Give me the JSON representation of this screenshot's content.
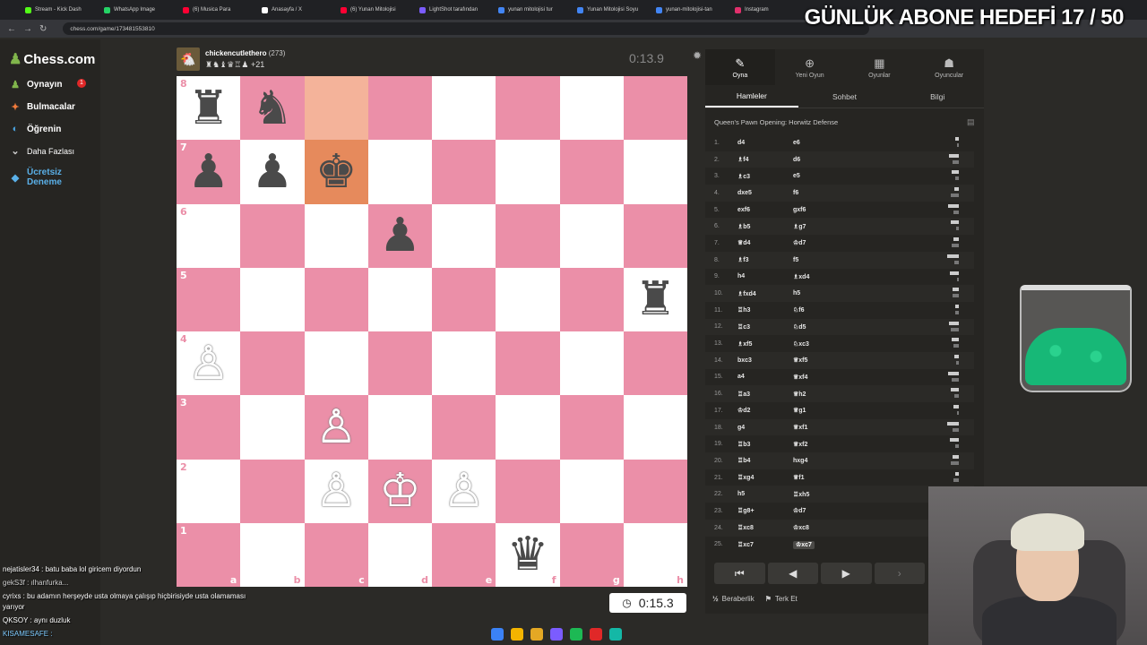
{
  "browser": {
    "tabs": [
      {
        "label": "Stream - Kick Dash",
        "color": "#53fc18"
      },
      {
        "label": "WhatsApp Image",
        "color": "#25d366"
      },
      {
        "label": "(6) Musica Para",
        "color": "#ff0033"
      },
      {
        "label": "Anasayfa / X",
        "color": "#ffffff"
      },
      {
        "label": "(6) Yunan Mitolojisi",
        "color": "#ff0033"
      },
      {
        "label": "LightShot tarafından",
        "color": "#7b5cff"
      },
      {
        "label": "yunan mitolojisi tur",
        "color": "#4285f4"
      },
      {
        "label": "Yunan Mitolojisi Soyu",
        "color": "#4285f4"
      },
      {
        "label": "yunan-mitolojisi-tan",
        "color": "#4285f4"
      },
      {
        "label": "Instagram",
        "color": "#e1306c"
      }
    ],
    "url": "chess.com/game/173481553810"
  },
  "stream_overlay": {
    "title": "GÜNLÜK ABONE HEDEFİ 17 / 50"
  },
  "sidebar": {
    "logo": "Chess.com",
    "items": [
      {
        "label": "Oynayın",
        "icon": "play-icon",
        "glyph": "♟",
        "color": "#81b64c"
      },
      {
        "label": "Bulmacalar",
        "icon": "puzzle-icon",
        "glyph": "✦",
        "color": "#f07a3b"
      },
      {
        "label": "Öğrenin",
        "icon": "learn-icon",
        "glyph": "◐",
        "color": "#4aa3df"
      },
      {
        "label": "Daha Fazlası",
        "icon": "more-icon",
        "glyph": "⌄",
        "color": "#cccccc"
      },
      {
        "label": "Ücretsiz\nDeneme",
        "icon": "diamond-icon",
        "glyph": "◆",
        "color": "#5ab0e8"
      }
    ],
    "notification_count": "1"
  },
  "top_player": {
    "name": "chickencutlethero",
    "rating": "(273)",
    "captured_diff": "+21",
    "captured_pieces": "♜♞♝♛♖♟",
    "clock": "0:13.9"
  },
  "bottom_player": {
    "clock": "0:15.3"
  },
  "board": {
    "ranks": [
      "8",
      "7",
      "6",
      "5",
      "4",
      "3",
      "2",
      "1"
    ],
    "files": [
      "a",
      "b",
      "c",
      "d",
      "e",
      "f",
      "g",
      "h"
    ],
    "pieces": {
      "a8": "♜",
      "b8": "♞",
      "a7": "♟",
      "b7": "♟",
      "c7": "♚",
      "d6": "♟",
      "h5": "♜",
      "a4": "♙",
      "c3": "♙",
      "c2": "♙",
      "d2": "♔",
      "e2": "♙",
      "f1": "♛"
    },
    "white_pieces": [
      "a4",
      "c3",
      "c2",
      "d2",
      "e2"
    ],
    "highlight": [
      "c8",
      "c7"
    ]
  },
  "panel": {
    "tabs": [
      {
        "label": "Oyna",
        "glyph": "✎",
        "icon": "play-tab-icon"
      },
      {
        "label": "Yeni Oyun",
        "glyph": "⊕",
        "icon": "new-game-icon"
      },
      {
        "label": "Oyunlar",
        "glyph": "▦",
        "icon": "games-icon"
      },
      {
        "label": "Oyuncular",
        "glyph": "☗",
        "icon": "players-icon"
      }
    ],
    "subtabs": [
      "Hamleler",
      "Sohbet",
      "Bilgi"
    ],
    "opening": "Queen's Pawn Opening: Horwitz Defense",
    "moves": [
      {
        "n": "1.",
        "w": "d4",
        "b": "e6"
      },
      {
        "n": "2.",
        "w": "♗f4",
        "b": "d6"
      },
      {
        "n": "3.",
        "w": "♗c3",
        "b": "e5"
      },
      {
        "n": "4.",
        "w": "dxe5",
        "b": "f6"
      },
      {
        "n": "5.",
        "w": "exf6",
        "b": "gxf6"
      },
      {
        "n": "6.",
        "w": "♗b5",
        "b": "♗g7"
      },
      {
        "n": "7.",
        "w": "♕d4",
        "b": "♔d7"
      },
      {
        "n": "8.",
        "w": "♗f3",
        "b": "f5"
      },
      {
        "n": "9.",
        "w": "h4",
        "b": "♗xd4"
      },
      {
        "n": "10.",
        "w": "♗fxd4",
        "b": "h5"
      },
      {
        "n": "11.",
        "w": "♖h3",
        "b": "♘f6"
      },
      {
        "n": "12.",
        "w": "♖c3",
        "b": "♘d5"
      },
      {
        "n": "13.",
        "w": "♗xf5",
        "b": "♘xc3"
      },
      {
        "n": "14.",
        "w": "bxc3",
        "b": "♕xf5"
      },
      {
        "n": "15.",
        "w": "a4",
        "b": "♕xf4"
      },
      {
        "n": "16.",
        "w": "♖a3",
        "b": "♕h2"
      },
      {
        "n": "17.",
        "w": "♔d2",
        "b": "♕g1"
      },
      {
        "n": "18.",
        "w": "g4",
        "b": "♕xf1"
      },
      {
        "n": "19.",
        "w": "♖b3",
        "b": "♕xf2"
      },
      {
        "n": "20.",
        "w": "♖b4",
        "b": "hxg4"
      },
      {
        "n": "21.",
        "w": "♖xg4",
        "b": "♕f1"
      },
      {
        "n": "22.",
        "w": "h5",
        "b": "♖xh5"
      },
      {
        "n": "23.",
        "w": "♖g8+",
        "b": "♔d7"
      },
      {
        "n": "24.",
        "w": "♖xc8",
        "b": "♔xc8"
      },
      {
        "n": "25.",
        "w": "♖xc7",
        "b": "♔xc7"
      }
    ],
    "actions": [
      {
        "label": "Beraberlik",
        "glyph": "½"
      },
      {
        "label": "Terk Et",
        "glyph": "⚑"
      }
    ]
  },
  "chat": [
    {
      "text": "nejatisler34 : batu baba lol giricem diyordun",
      "color": "#ffffff"
    },
    {
      "text": "gekS3f : ılhanfurka...",
      "color": "#cfcfcf"
    },
    {
      "text": "cyrixs : bu adamın herşeyde usta olmaya çalışıp hiçbirisiyde usta olamaması",
      "color": "#ffffff"
    },
    {
      "text": "yarıyor",
      "color": "#ffffff"
    },
    {
      "text": "QKSOY : aynı duzluk",
      "color": "#ffffff"
    },
    {
      "text": "KISAMESAFE :",
      "color": "#7ecbff"
    }
  ]
}
